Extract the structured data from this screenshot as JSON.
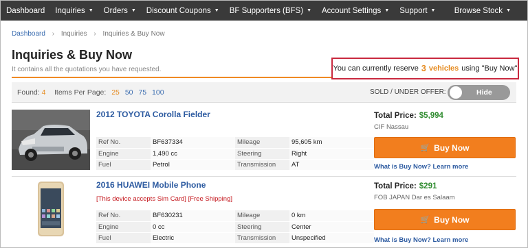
{
  "nav": {
    "items": [
      "Dashboard",
      "Inquiries",
      "Orders",
      "Discount Coupons",
      "BF Supporters (BFS)",
      "Account Settings",
      "Support"
    ],
    "right": "Browse Stock"
  },
  "breadcrumb": [
    "Dashboard",
    "Inquiries",
    "Inquiries & Buy Now"
  ],
  "page": {
    "title": "Inquiries & Buy Now",
    "subtitle": "It contains all the quotations you have requested."
  },
  "reserve": {
    "prefix": "You can currently reserve",
    "count": "3",
    "unit": "vehicles",
    "suffix": "using \"Buy Now\""
  },
  "filter": {
    "found_label": "Found:",
    "found_value": "4",
    "per_page_label": "Items Per Page:",
    "per_page_options": [
      "25",
      "50",
      "75",
      "100"
    ],
    "per_page_selected": "25",
    "sold_label": "SOLD / UNDER OFFER:",
    "toggle_label": "Hide"
  },
  "listings": [
    {
      "title": "2012 TOYOTA Corolla Fielder",
      "notice": "",
      "specs": [
        [
          "Ref No.",
          "BF637334",
          "Mileage",
          "95,605 km"
        ],
        [
          "Engine",
          "1,490 cc",
          "Steering",
          "Right"
        ],
        [
          "Fuel",
          "Petrol",
          "Transmission",
          "AT"
        ]
      ],
      "price_label": "Total Price:",
      "price": "$5,994",
      "price_terms": "CIF Nassau",
      "buy_label": "Buy Now",
      "learn_label": "What is Buy Now? Learn more"
    },
    {
      "title": "2016 HUAWEI Mobile Phone",
      "notice": "[This device accepts Sim Card] [Free Shipping]",
      "specs": [
        [
          "Ref No.",
          "BF630231",
          "Mileage",
          "0 km"
        ],
        [
          "Engine",
          "0 cc",
          "Steering",
          "Center"
        ],
        [
          "Fuel",
          "Electric",
          "Transmission",
          "Unspecified"
        ]
      ],
      "price_label": "Total Price:",
      "price": "$291",
      "price_terms": "FOB JAPAN Dar es Salaam",
      "buy_label": "Buy Now",
      "learn_label": "What is Buy Now? Learn more"
    }
  ],
  "colors": {
    "nav_bg": "#3a3a3a",
    "accent_orange": "#f27e1e",
    "link_blue": "#2c5aa0",
    "price_green": "#2e8b2e",
    "highlight_red": "#c9283e"
  }
}
